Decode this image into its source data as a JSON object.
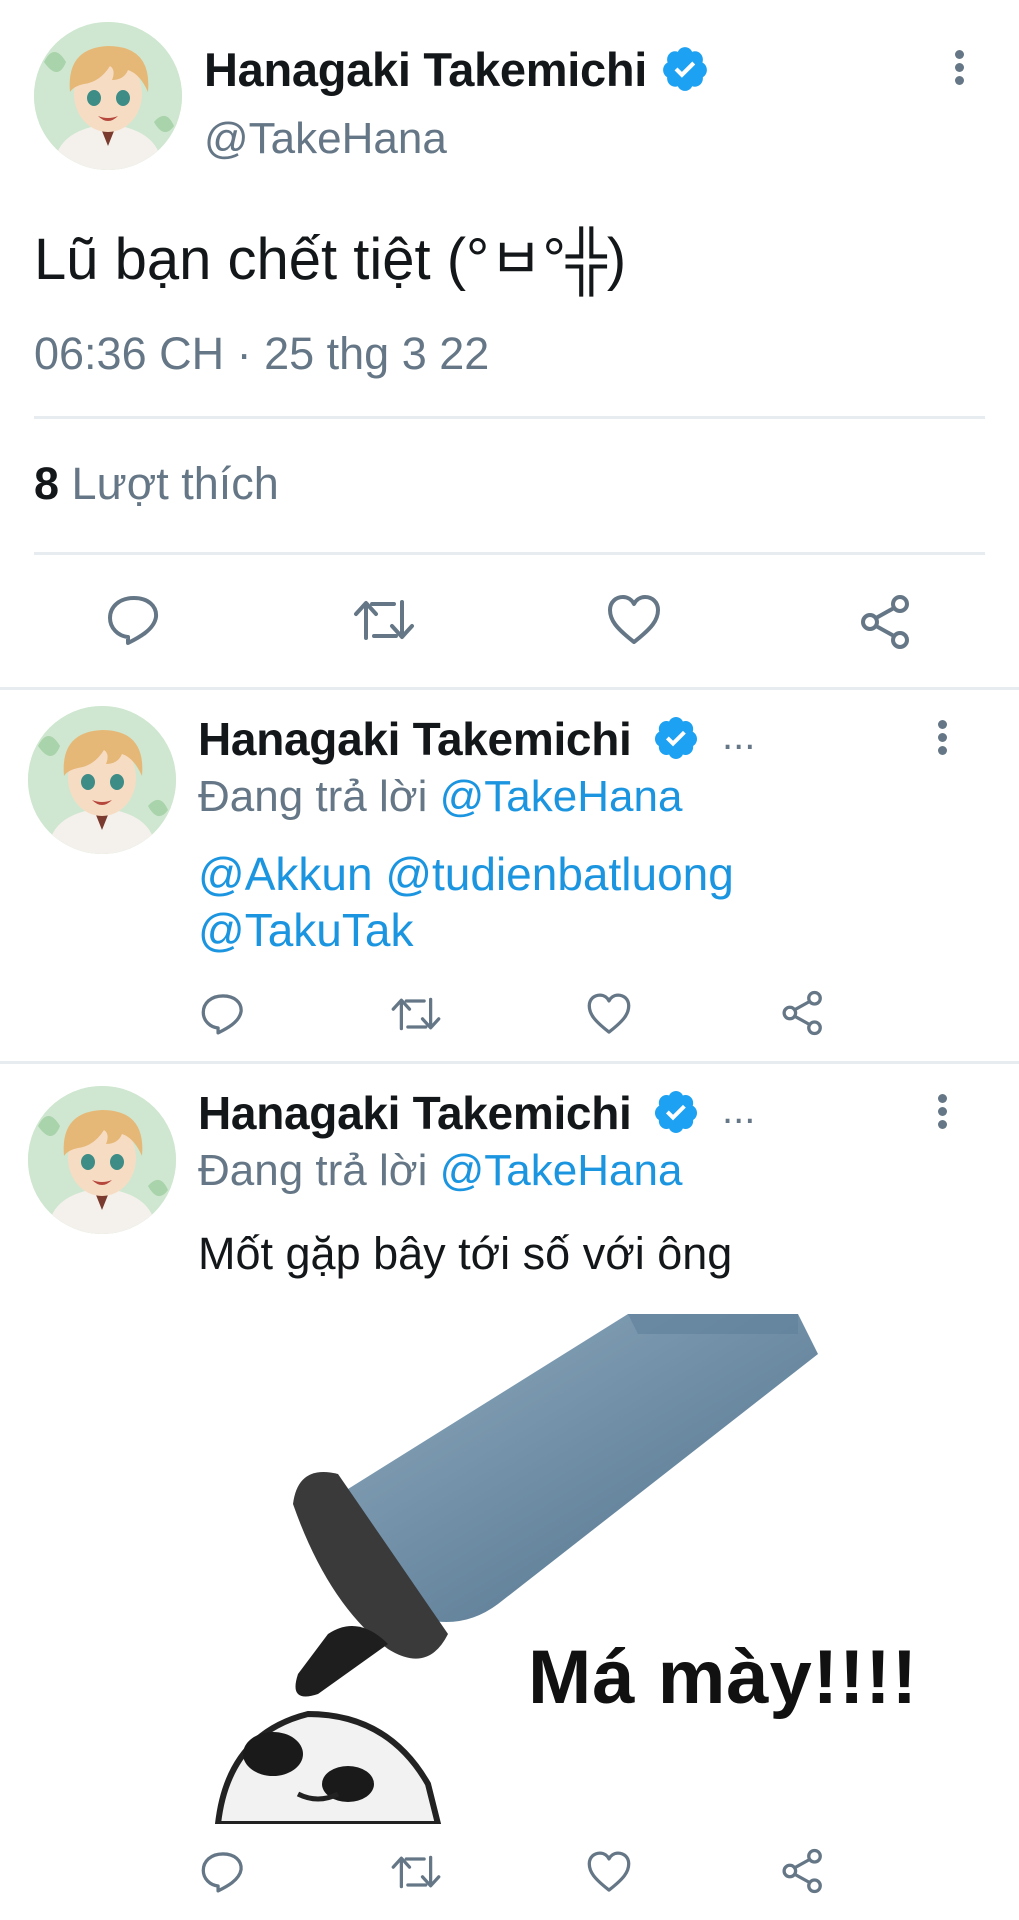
{
  "main_tweet": {
    "display_name": "Hanagaki Takemichi",
    "handle": "@TakeHana",
    "text": "Lũ bạn chết tiệt (°ㅂ°╬)",
    "timestamp": "06:36 CH · 25 thg 3 22",
    "likes_count": "8",
    "likes_label": "Lượt thích",
    "actions": [
      "reply-icon",
      "retweet-icon",
      "like-icon",
      "share-icon"
    ]
  },
  "replies": [
    {
      "display_name": "Hanagaki Takemichi",
      "overflow": "...",
      "replying_prefix": "Đang trả lời",
      "replying_to": "@TakeHana",
      "mentions_line1": "@Akkun @tudienbatluong",
      "mentions_line2": "@TakuTak"
    },
    {
      "display_name": "Hanagaki Takemichi",
      "overflow": "...",
      "replying_prefix": "Đang trả lời",
      "replying_to": "@TakeHana",
      "text": "Mốt gặp bây tới số với ông",
      "media_caption": "Má mày!!!!"
    }
  ],
  "colors": {
    "verified": "#1da1f2",
    "link": "#1b95e0",
    "secondary_text": "#657786",
    "divider": "#e6ecf0"
  }
}
